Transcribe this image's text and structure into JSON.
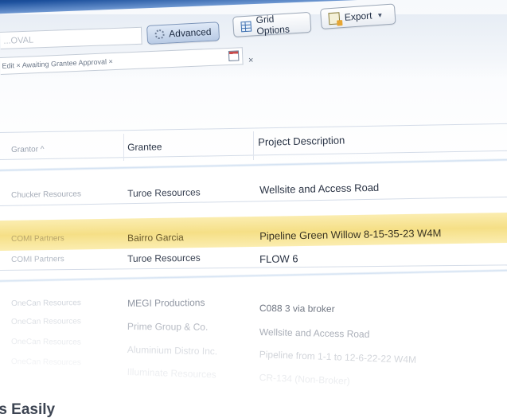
{
  "toolbar": {
    "search_placeholder": "...OVAL",
    "advanced_label": "Advanced",
    "grid_options_label": "Grid Options",
    "export_label": "Export"
  },
  "filter": {
    "text": "Edit × Awaiting Grantee Approval ×",
    "clear_symbol": "×"
  },
  "table": {
    "columns": [
      "Grantor ^",
      "Grantee",
      "Project Description"
    ],
    "rows": [
      {
        "grantor": "Chucker Resources",
        "grantee": "Turoe Resources",
        "description": "Wellsite and Access Road"
      },
      {
        "grantor": "COMI Partners",
        "grantee": "Bairro Garcia",
        "description": "Pipeline Green Willow 8-15-35-23 W4M",
        "selected": true
      },
      {
        "grantor": "COMI Partners",
        "grantee": "Turoe Resources",
        "description": "FLOW 6"
      },
      {
        "grantor": "OneCan Resources",
        "grantee": "MEGI Productions",
        "description": "C088 3 via broker"
      },
      {
        "grantor": "OneCan Resources",
        "grantee": "Prime Group & Co.",
        "description": "Wellsite and Access Road"
      },
      {
        "grantor": "OneCan Resources",
        "grantee": "Aluminium Distro Inc.",
        "description": "Pipeline from 1-1 to 12-6-22-22 W4M"
      },
      {
        "grantor": "OneCan Resources",
        "grantee": "Illuminate Resources",
        "description": "CR-134 (Non-Broker)"
      }
    ]
  },
  "tagline": "ts Easily",
  "colors": {
    "accent": "#1b4f9c",
    "selected_row": "#f5df86"
  }
}
